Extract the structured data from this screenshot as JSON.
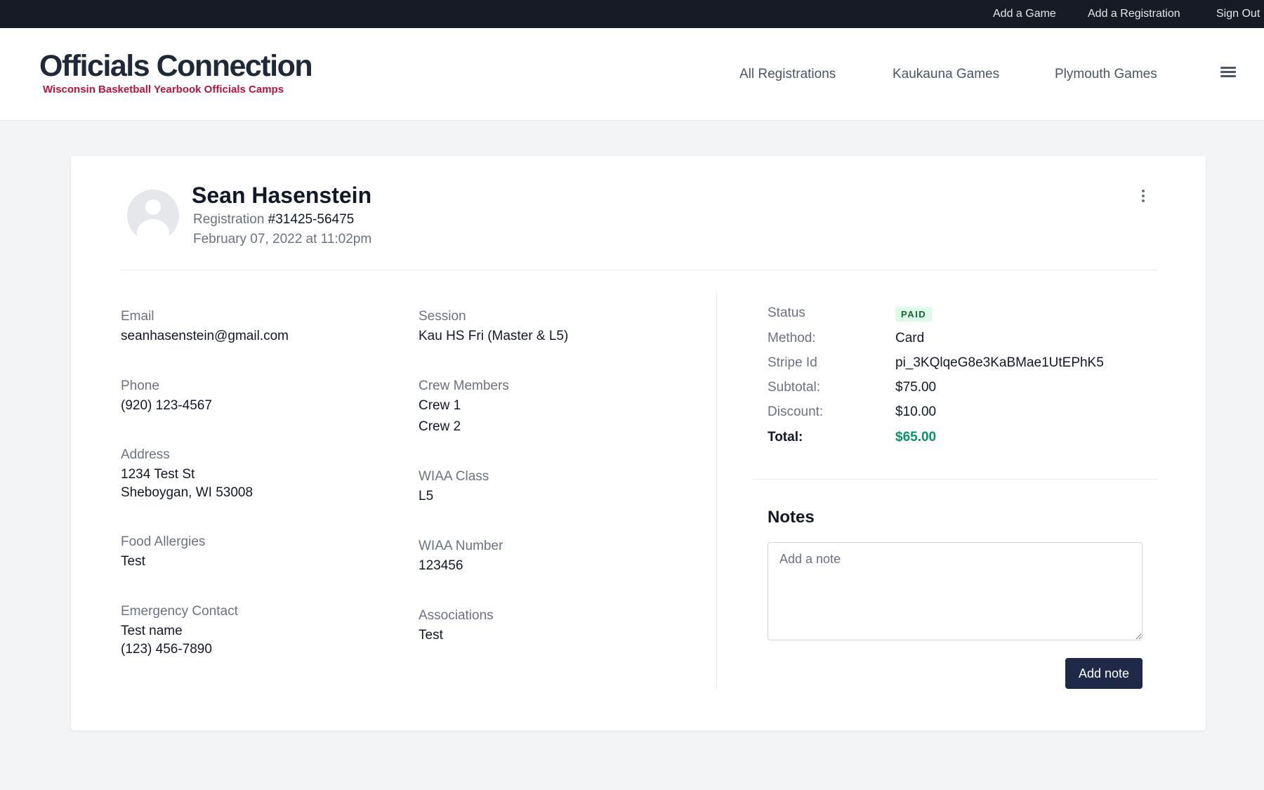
{
  "topbar": {
    "links": [
      {
        "label": "Add a Game"
      },
      {
        "label": "Add a Registration"
      },
      {
        "label": "Sign Out"
      }
    ]
  },
  "header": {
    "title": "Officials Connection",
    "subtitle": "Wisconsin Basketball Yearbook Officials Camps",
    "nav": [
      {
        "label": "All Registrations"
      },
      {
        "label": "Kaukauna Games"
      },
      {
        "label": "Plymouth Games"
      }
    ],
    "menu_icon": "hamburger-icon"
  },
  "registration": {
    "name": "Sean Hasenstein",
    "registration_label": "Registration",
    "registration_number": "#31425-56475",
    "date": "February 07, 2022 at 11:02pm"
  },
  "details_left": [
    {
      "label": "Email",
      "lines": [
        "seanhasenstein@gmail.com"
      ]
    },
    {
      "label": "Phone",
      "lines": [
        "(920) 123-4567"
      ]
    },
    {
      "label": "Address",
      "lines": [
        "1234 Test St",
        "Sheboygan, WI 53008"
      ]
    },
    {
      "label": "Food Allergies",
      "lines": [
        "Test"
      ]
    },
    {
      "label": "Emergency Contact",
      "lines": [
        "Test name",
        "(123) 456-7890"
      ]
    }
  ],
  "details_middle": [
    {
      "label": "Session",
      "lines": [
        "Kau HS Fri (Master & L5)"
      ]
    },
    {
      "label": "Crew Members",
      "lines": [
        "Crew 1",
        "Crew 2"
      ]
    },
    {
      "label": "WIAA Class",
      "lines": [
        "L5"
      ]
    },
    {
      "label": "WIAA Number",
      "lines": [
        "123456"
      ]
    },
    {
      "label": "Associations",
      "lines": [
        "Test"
      ]
    }
  ],
  "payment": {
    "status_label": "Status",
    "status_value": "PAID",
    "status_color": "#dcfce7",
    "rows": [
      {
        "label": "Method:",
        "value": "Card"
      },
      {
        "label": "Stripe Id",
        "value": "pi_3KQlqeG8e3KaBMae1UtEPhK5"
      },
      {
        "label": "Subtotal:",
        "value": "$75.00"
      },
      {
        "label": "Discount:",
        "value": "$10.00"
      },
      {
        "label": "Total:",
        "value": "$65.00"
      }
    ],
    "total_color": "#059669"
  },
  "notes": {
    "title": "Notes",
    "placeholder": "Add a note",
    "button_label": "Add note"
  }
}
